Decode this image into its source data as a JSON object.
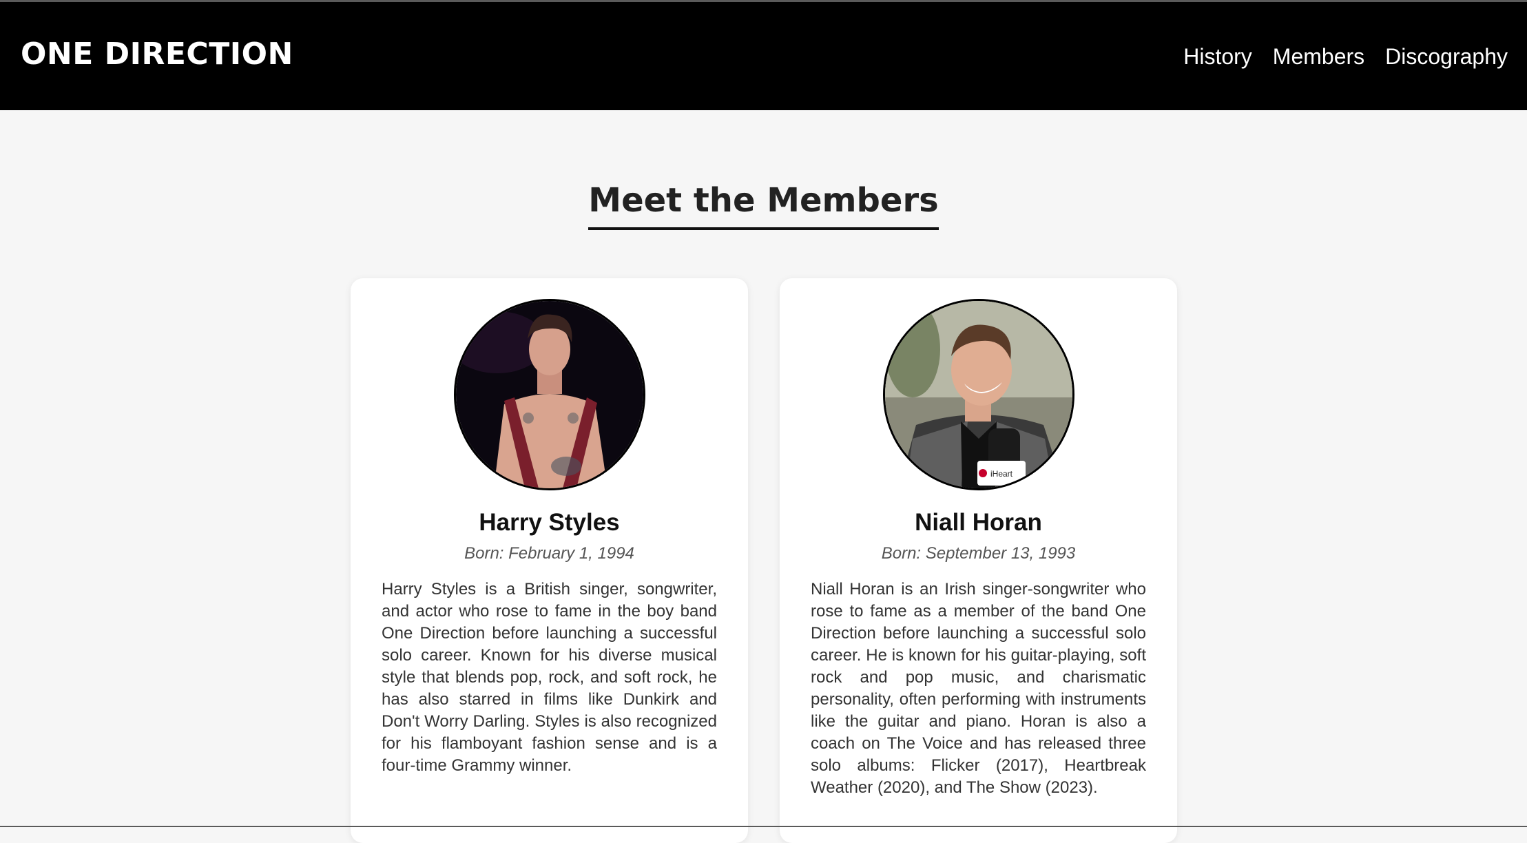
{
  "brand": "ONE DIRECTION",
  "nav": [
    "History",
    "Members",
    "Discography"
  ],
  "section_title": "Meet the Members",
  "members": [
    {
      "name": "Harry Styles",
      "born": "Born: February 1, 1994",
      "bio": "Harry Styles is a British singer, songwriter, and actor who rose to fame in the boy band One Direction before launching a successful solo career. Known for his diverse musical style that blends pop, rock, and soft rock, he has also starred in films like Dunkirk and Don't Worry Darling. Styles is also recognized for his flamboyant fashion sense and is a four-time Grammy winner."
    },
    {
      "name": "Niall Horan",
      "born": "Born: September 13, 1993",
      "bio": "Niall Horan is an Irish singer-songwriter who rose to fame as a member of the band One Direction before launching a successful solo career. He is known for his guitar-playing, soft rock and pop music, and charismatic personality, often performing with instruments like the guitar and piano. Horan is also a coach on The Voice and has released three solo albums: Flicker (2017), Heartbreak Weather (2020), and The Show (2023).",
      "photo_badge": "iHeart"
    }
  ],
  "colors": {
    "header_bg": "#000000",
    "page_bg": "#f6f6f6",
    "card_bg": "#ffffff"
  },
  "icons": [
    "harry-styles-photo",
    "niall-horan-photo"
  ]
}
